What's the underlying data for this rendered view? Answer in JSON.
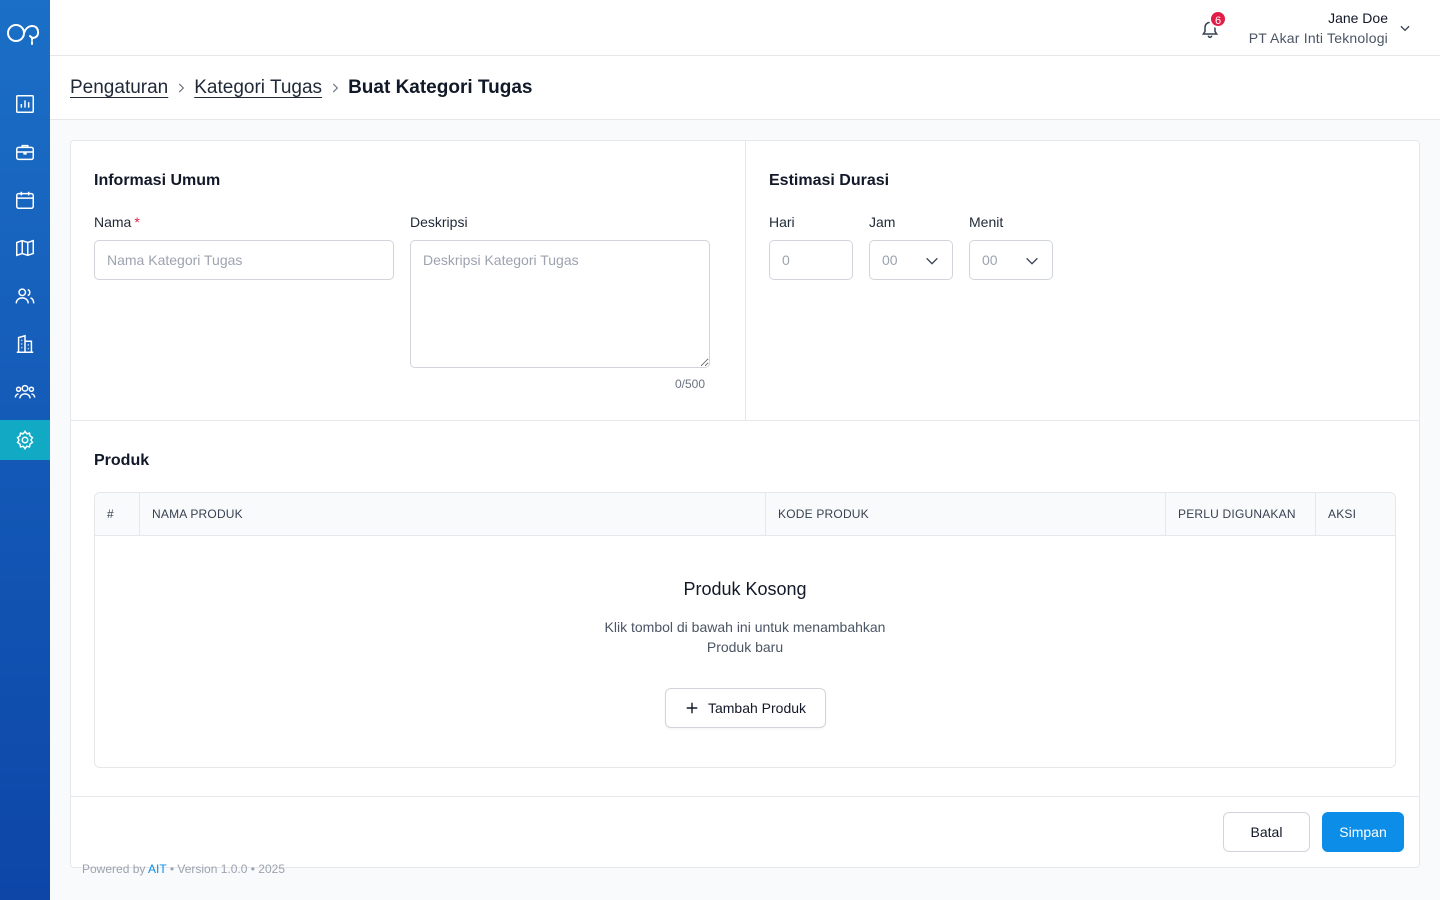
{
  "header": {
    "notification_count": "6",
    "user_name": "Jane Doe",
    "user_org": "PT Akar Inti Teknologi"
  },
  "sidebar": {
    "items": [
      {
        "icon": "chart-icon"
      },
      {
        "icon": "briefcase-icon"
      },
      {
        "icon": "calendar-icon"
      },
      {
        "icon": "map-icon"
      },
      {
        "icon": "users-icon"
      },
      {
        "icon": "building-icon"
      },
      {
        "icon": "team-icon"
      },
      {
        "icon": "gear-icon",
        "active": true
      }
    ],
    "active_color": "#11a9c4"
  },
  "breadcrumb": {
    "items": [
      "Pengaturan",
      "Kategori Tugas"
    ],
    "current": "Buat Kategori Tugas"
  },
  "general_info": {
    "title": "Informasi Umum",
    "name_label": "Nama",
    "required_mark": "*",
    "name_placeholder": "Nama Kategori Tugas",
    "description_label": "Deskripsi",
    "description_placeholder": "Deskripsi Kategori Tugas",
    "description_counter": "0/500"
  },
  "duration": {
    "title": "Estimasi Durasi",
    "day_label": "Hari",
    "day_placeholder": "0",
    "hour_label": "Jam",
    "hour_value": "00",
    "minute_label": "Menit",
    "minute_value": "00"
  },
  "products": {
    "title": "Produk",
    "columns": [
      "#",
      "NAMA PRODUK",
      "KODE PRODUK",
      "PERLU DIGUNAKAN",
      "AKSI"
    ],
    "empty_title": "Produk Kosong",
    "empty_desc_line1": "Klik tombol di bawah ini untuk menambahkan",
    "empty_desc_line2": "Produk baru",
    "add_label": "Tambah Produk"
  },
  "footer": {
    "cancel_label": "Batal",
    "save_label": "Simpan",
    "powered_prefix": "Powered by",
    "powered_brand": "AIT",
    "powered_suffix": "• Version 1.0.0 • 2025"
  },
  "colors": {
    "primary": "#0b8de8",
    "required": "#e11d48",
    "badge": "#e11d48"
  }
}
